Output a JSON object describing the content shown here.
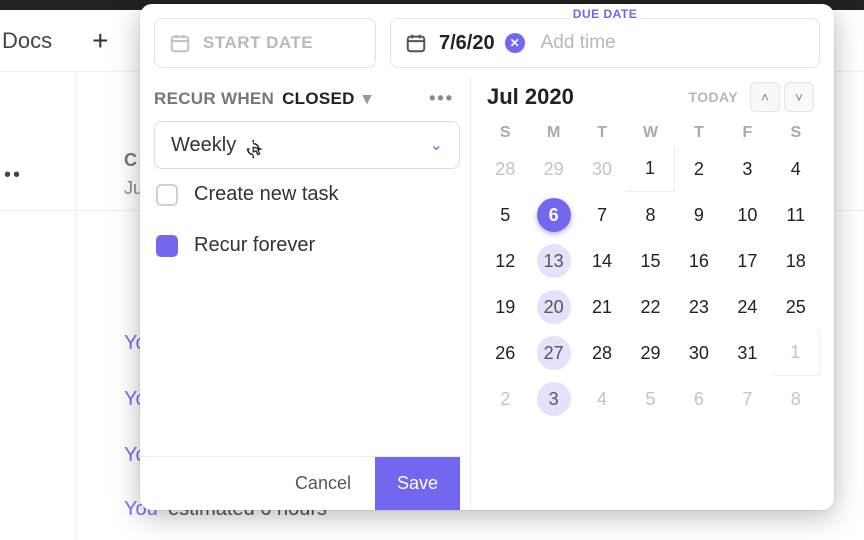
{
  "bg": {
    "docs": "Docs",
    "plus": "+",
    "activity_label": "C",
    "activity_sub": "Ju",
    "you": "You",
    "estimate_tail": "estimated 6 hours"
  },
  "modal": {
    "start_placeholder": "START DATE",
    "due_label": "DUE DATE",
    "due_date": "7/6/20",
    "add_time": "Add time",
    "recur_when": "RECUR WHEN",
    "recur_state": "CLOSED",
    "frequency": "Weekly",
    "opt_create": "Create new task",
    "opt_forever": "Recur forever",
    "create_checked": false,
    "forever_checked": true,
    "footer": {
      "cancel": "Cancel",
      "save": "Save"
    }
  },
  "calendar": {
    "month": "Jul 2020",
    "today": "TODAY",
    "dow": [
      "S",
      "M",
      "T",
      "W",
      "T",
      "F",
      "S"
    ],
    "weeks": [
      [
        {
          "d": "28",
          "adj": true
        },
        {
          "d": "29",
          "adj": true
        },
        {
          "d": "30",
          "adj": true
        },
        {
          "d": "1",
          "boxed": true
        },
        {
          "d": "2"
        },
        {
          "d": "3"
        },
        {
          "d": "4"
        }
      ],
      [
        {
          "d": "5"
        },
        {
          "d": "6",
          "selected": true
        },
        {
          "d": "7"
        },
        {
          "d": "8"
        },
        {
          "d": "9"
        },
        {
          "d": "10"
        },
        {
          "d": "11"
        }
      ],
      [
        {
          "d": "12"
        },
        {
          "d": "13",
          "hl": true
        },
        {
          "d": "14"
        },
        {
          "d": "15"
        },
        {
          "d": "16"
        },
        {
          "d": "17"
        },
        {
          "d": "18"
        }
      ],
      [
        {
          "d": "19"
        },
        {
          "d": "20",
          "hl": true
        },
        {
          "d": "21"
        },
        {
          "d": "22"
        },
        {
          "d": "23"
        },
        {
          "d": "24"
        },
        {
          "d": "25"
        }
      ],
      [
        {
          "d": "26"
        },
        {
          "d": "27",
          "hl": true
        },
        {
          "d": "28"
        },
        {
          "d": "29"
        },
        {
          "d": "30"
        },
        {
          "d": "31"
        },
        {
          "d": "1",
          "adj": true,
          "boxed": true
        }
      ],
      [
        {
          "d": "2",
          "adj": true
        },
        {
          "d": "3",
          "adj": true,
          "hl": true
        },
        {
          "d": "4",
          "adj": true
        },
        {
          "d": "5",
          "adj": true
        },
        {
          "d": "6",
          "adj": true
        },
        {
          "d": "7",
          "adj": true
        },
        {
          "d": "8",
          "adj": true
        }
      ]
    ]
  }
}
